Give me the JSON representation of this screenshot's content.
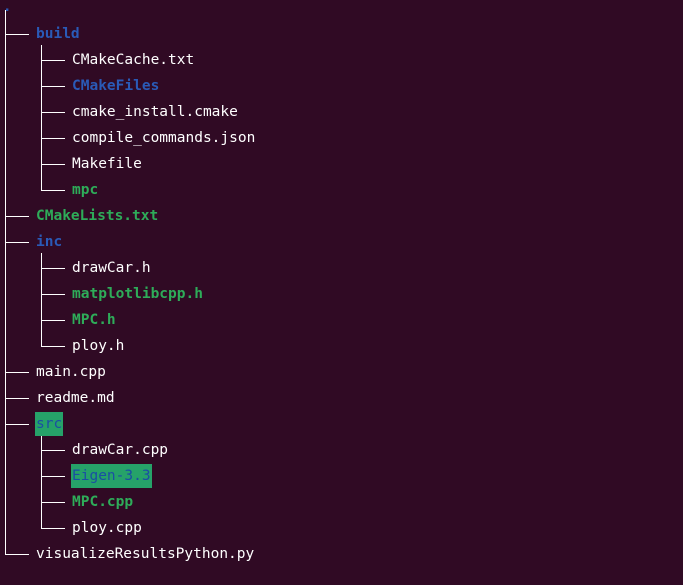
{
  "terminal": {
    "root": ".",
    "tree": [
      {
        "name": "build",
        "kind": "dir",
        "depth": 0
      },
      {
        "name": "CMakeCache.txt",
        "kind": "file",
        "depth": 1
      },
      {
        "name": "CMakeFiles",
        "kind": "dir",
        "depth": 1
      },
      {
        "name": "cmake_install.cmake",
        "kind": "file",
        "depth": 1
      },
      {
        "name": "compile_commands.json",
        "kind": "file",
        "depth": 1
      },
      {
        "name": "Makefile",
        "kind": "file",
        "depth": 1
      },
      {
        "name": "mpc",
        "kind": "exec",
        "depth": 1,
        "last": true
      },
      {
        "name": "CMakeLists.txt",
        "kind": "exec",
        "depth": 0
      },
      {
        "name": "inc",
        "kind": "dir",
        "depth": 0
      },
      {
        "name": "drawCar.h",
        "kind": "file",
        "depth": 1
      },
      {
        "name": "matplotlibcpp.h",
        "kind": "exec",
        "depth": 1
      },
      {
        "name": "MPC.h",
        "kind": "exec",
        "depth": 1
      },
      {
        "name": "ploy.h",
        "kind": "file",
        "depth": 1,
        "last": true
      },
      {
        "name": "main.cpp",
        "kind": "file",
        "depth": 0
      },
      {
        "name": "readme.md",
        "kind": "file",
        "depth": 0
      },
      {
        "name": "src",
        "kind": "dir-highlight",
        "depth": 0
      },
      {
        "name": "drawCar.cpp",
        "kind": "file",
        "depth": 1
      },
      {
        "name": "Eigen-3.3",
        "kind": "dir-highlight",
        "depth": 1
      },
      {
        "name": "MPC.cpp",
        "kind": "exec",
        "depth": 1
      },
      {
        "name": "ploy.cpp",
        "kind": "file",
        "depth": 1,
        "last": true
      },
      {
        "name": "visualizeResultsPython.py",
        "kind": "file",
        "depth": 0,
        "last": true
      }
    ]
  },
  "colors": {
    "background": "#300a24",
    "directory": "#2a5ab7",
    "executable": "#2eac59",
    "highlight_bg": "#26a269",
    "text": "#ffffff"
  }
}
